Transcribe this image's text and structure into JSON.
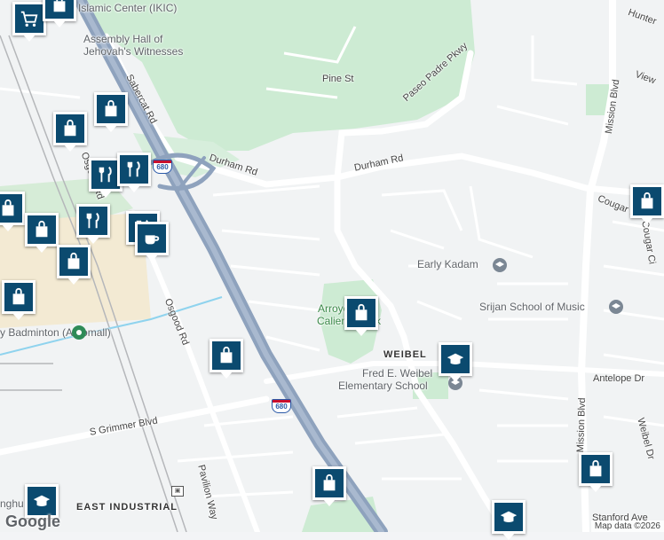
{
  "map": {
    "labels": {
      "islamic_center": "Islamic Center (IKIC)",
      "assembly_hall": "Assembly Hall of Jehovah's Witnesses",
      "pine_st": "Pine St",
      "paseo_padre": "Paseo Padre Pkwy",
      "sabercat": "Sabercat Rd",
      "durham_rd_left": "Durham Rd",
      "durham_rd_right": "Durham Rd",
      "osgood_top": "Osgood Rd",
      "osgood_bottom": "Osgood Rd",
      "mission_blvd_top": "Mission Blvd",
      "mission_blvd_bottom": "Mission Blvd",
      "hunter": "Hunter",
      "view": "View",
      "cougar_dr": "Cougar Dr",
      "cougar_circle": "Cougar Ci",
      "early_kadam": "Early Kadam",
      "srijan": "Srijan School of Music",
      "arroyo_line1": "Arroyo Agua",
      "arroyo_line2": "Caliente Park",
      "weibel": "WEIBEL",
      "fred_line1": "Fred E. Weibel",
      "fred_line2": "Elementary School",
      "antelope": "Antelope Dr",
      "weibel_dr": "Weibel Dr",
      "badminton": "y Badminton (Automall)",
      "grimmer": "S Grimmer Blvd",
      "pavilion": "Pavilion Way",
      "east_industrial": "EAST INDUSTRIAL",
      "stanford": "Stanford Ave",
      "nghu": "nghu"
    },
    "highway_shields": [
      "680",
      "680"
    ],
    "google_logo": "Google",
    "attribution": "Map data ©2026",
    "colors": {
      "background": "#f3f4f6",
      "park": "#cdebd3",
      "parking": "#f3ead3",
      "highway": "#8ea2bd",
      "road": "#ffffff",
      "pin": "#0b4a6f",
      "creek": "#8fd3ee"
    },
    "pins": [
      {
        "name": "shopping-cart-icon"
      },
      {
        "name": "store-bag-icon"
      },
      {
        "name": "store-bag-icon"
      },
      {
        "name": "store-bag-icon"
      },
      {
        "name": "restaurant-icon"
      },
      {
        "name": "restaurant-icon"
      },
      {
        "name": "store-bag-icon"
      },
      {
        "name": "restaurant-icon"
      },
      {
        "name": "store-bag-icon"
      },
      {
        "name": "restaurant-icon"
      },
      {
        "name": "cafe-icon"
      },
      {
        "name": "store-bag-icon"
      },
      {
        "name": "store-bag-icon"
      },
      {
        "name": "store-bag-icon"
      },
      {
        "name": "store-bag-icon"
      },
      {
        "name": "school-icon"
      },
      {
        "name": "store-bag-icon"
      },
      {
        "name": "store-bag-icon"
      },
      {
        "name": "school-icon"
      },
      {
        "name": "school-icon"
      },
      {
        "name": "school-icon"
      }
    ]
  }
}
